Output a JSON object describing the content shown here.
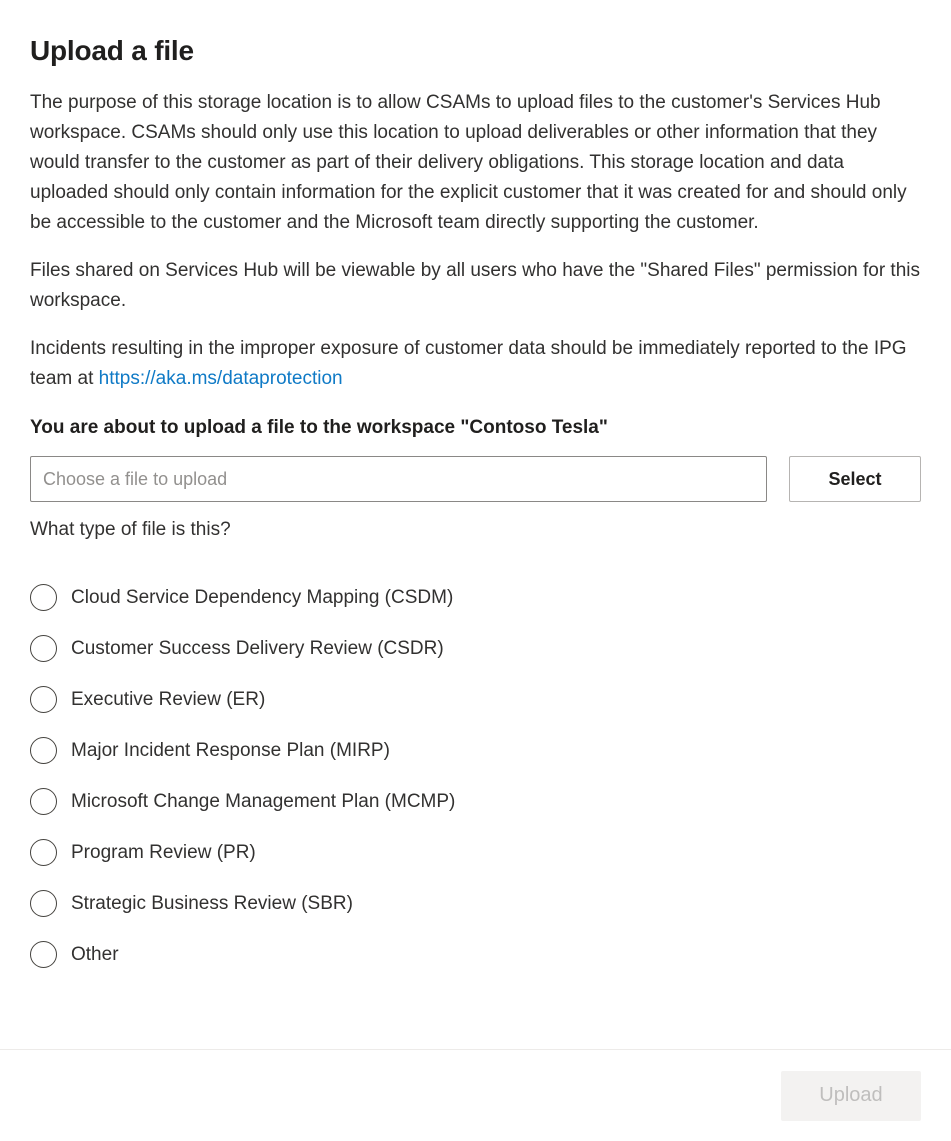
{
  "dialog": {
    "title": "Upload a file",
    "close_icon": "close-icon",
    "paragraphs": [
      "The purpose of this storage location is to allow CSAMs to upload files to the customer's Services Hub workspace. CSAMs should only use this location to upload deliverables or other information that they would transfer to the customer as part of their delivery obligations. This storage location and data uploaded should only contain information for the explicit customer that it was created for and should only be accessible to the customer and the Microsoft team directly supporting the customer.",
      "Files shared on Services Hub will be viewable by all users who have the \"Shared Files\" permission for this workspace."
    ],
    "incident_paragraph": {
      "prefix": "Incidents resulting in the improper exposure of customer data should be immediately reported to the IPG team at ",
      "link_text": "https://aka.ms/dataprotection"
    },
    "workspace_line": "You are about to upload a file to the workspace \"Contoso Tesla\"",
    "file_picker": {
      "value": "",
      "placeholder": "Choose a file to upload",
      "select_label": "Select"
    },
    "question_label": "What type of file is this?",
    "file_types": [
      {
        "label": "Cloud Service Dependency Mapping (CSDM)",
        "checked": false
      },
      {
        "label": "Customer Success Delivery Review (CSDR)",
        "checked": false
      },
      {
        "label": "Executive Review (ER)",
        "checked": false
      },
      {
        "label": "Major Incident Response Plan (MIRP)",
        "checked": false
      },
      {
        "label": "Microsoft Change Management Plan (MCMP)",
        "checked": false
      },
      {
        "label": "Program Review (PR)",
        "checked": false
      },
      {
        "label": "Strategic Business Review (SBR)",
        "checked": false
      },
      {
        "label": "Other",
        "checked": false
      }
    ],
    "footer": {
      "upload_label": "Upload",
      "upload_disabled": true
    },
    "colors": {
      "link": "#0f7ac6",
      "text": "#323130",
      "title": "#201f1e",
      "border": "#8a8886",
      "divider": "#edebe9",
      "disabled_button_bg": "#f3f2f1",
      "disabled_button_text": "#bfbebd"
    }
  }
}
